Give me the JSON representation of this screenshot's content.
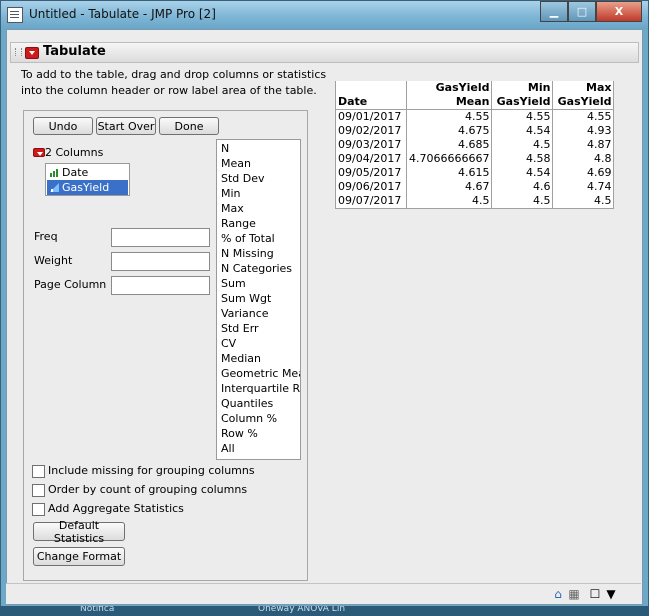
{
  "window": {
    "title": "Untitled - Tabulate - JMP Pro [2]",
    "min_glyph": "▁",
    "max_glyph": "□",
    "close_glyph": "X"
  },
  "report": {
    "title": "Tabulate"
  },
  "instructions": {
    "line1": "To add to the table, drag and drop columns or statistics",
    "line2": "into the column header or row label area of the table."
  },
  "buttons": {
    "undo": "Undo",
    "start_over": "Start Over",
    "done": "Done",
    "default_statistics": "Default Statistics",
    "change_format": "Change Format"
  },
  "columns": {
    "label": "2 Columns",
    "items": [
      "Date",
      "GasYield"
    ]
  },
  "fields": {
    "freq": "Freq",
    "weight": "Weight",
    "page_column": "Page Column"
  },
  "statistics": [
    "N",
    "Mean",
    "Std Dev",
    "Min",
    "Max",
    "Range",
    "% of Total",
    "N Missing",
    "N Categories",
    "Sum",
    "Sum Wgt",
    "Variance",
    "Std Err",
    "CV",
    "Median",
    "Geometric Mea",
    "Interquartile Ra",
    "Quantiles",
    "Column %",
    "Row %",
    "All"
  ],
  "options": {
    "include_missing": "Include missing for grouping columns",
    "order_by_count": "Order by count of grouping columns",
    "add_aggregate": "Add Aggregate Statistics"
  },
  "table": {
    "header_row1": [
      "",
      "GasYield",
      "Min",
      "Max"
    ],
    "header_row2": [
      "Date",
      "Mean",
      "GasYield",
      "GasYield"
    ],
    "rows": [
      [
        "09/01/2017",
        "4.55",
        "4.55",
        "4.55"
      ],
      [
        "09/02/2017",
        "4.675",
        "4.54",
        "4.93"
      ],
      [
        "09/03/2017",
        "4.685",
        "4.5",
        "4.87"
      ],
      [
        "09/04/2017",
        "4.7066666667",
        "4.58",
        "4.8"
      ],
      [
        "09/05/2017",
        "4.615",
        "4.54",
        "4.69"
      ],
      [
        "09/06/2017",
        "4.67",
        "4.6",
        "4.74"
      ],
      [
        "09/07/2017",
        "4.5",
        "4.5",
        "4.5"
      ]
    ]
  },
  "taskbar": {
    "item1": "Notifica",
    "item2": "Oneway ANOVA Lin"
  },
  "colors": {
    "selection": "#3a70c8",
    "red_menu": "#cc1b1b",
    "title_bar": "#7fb6d6"
  }
}
